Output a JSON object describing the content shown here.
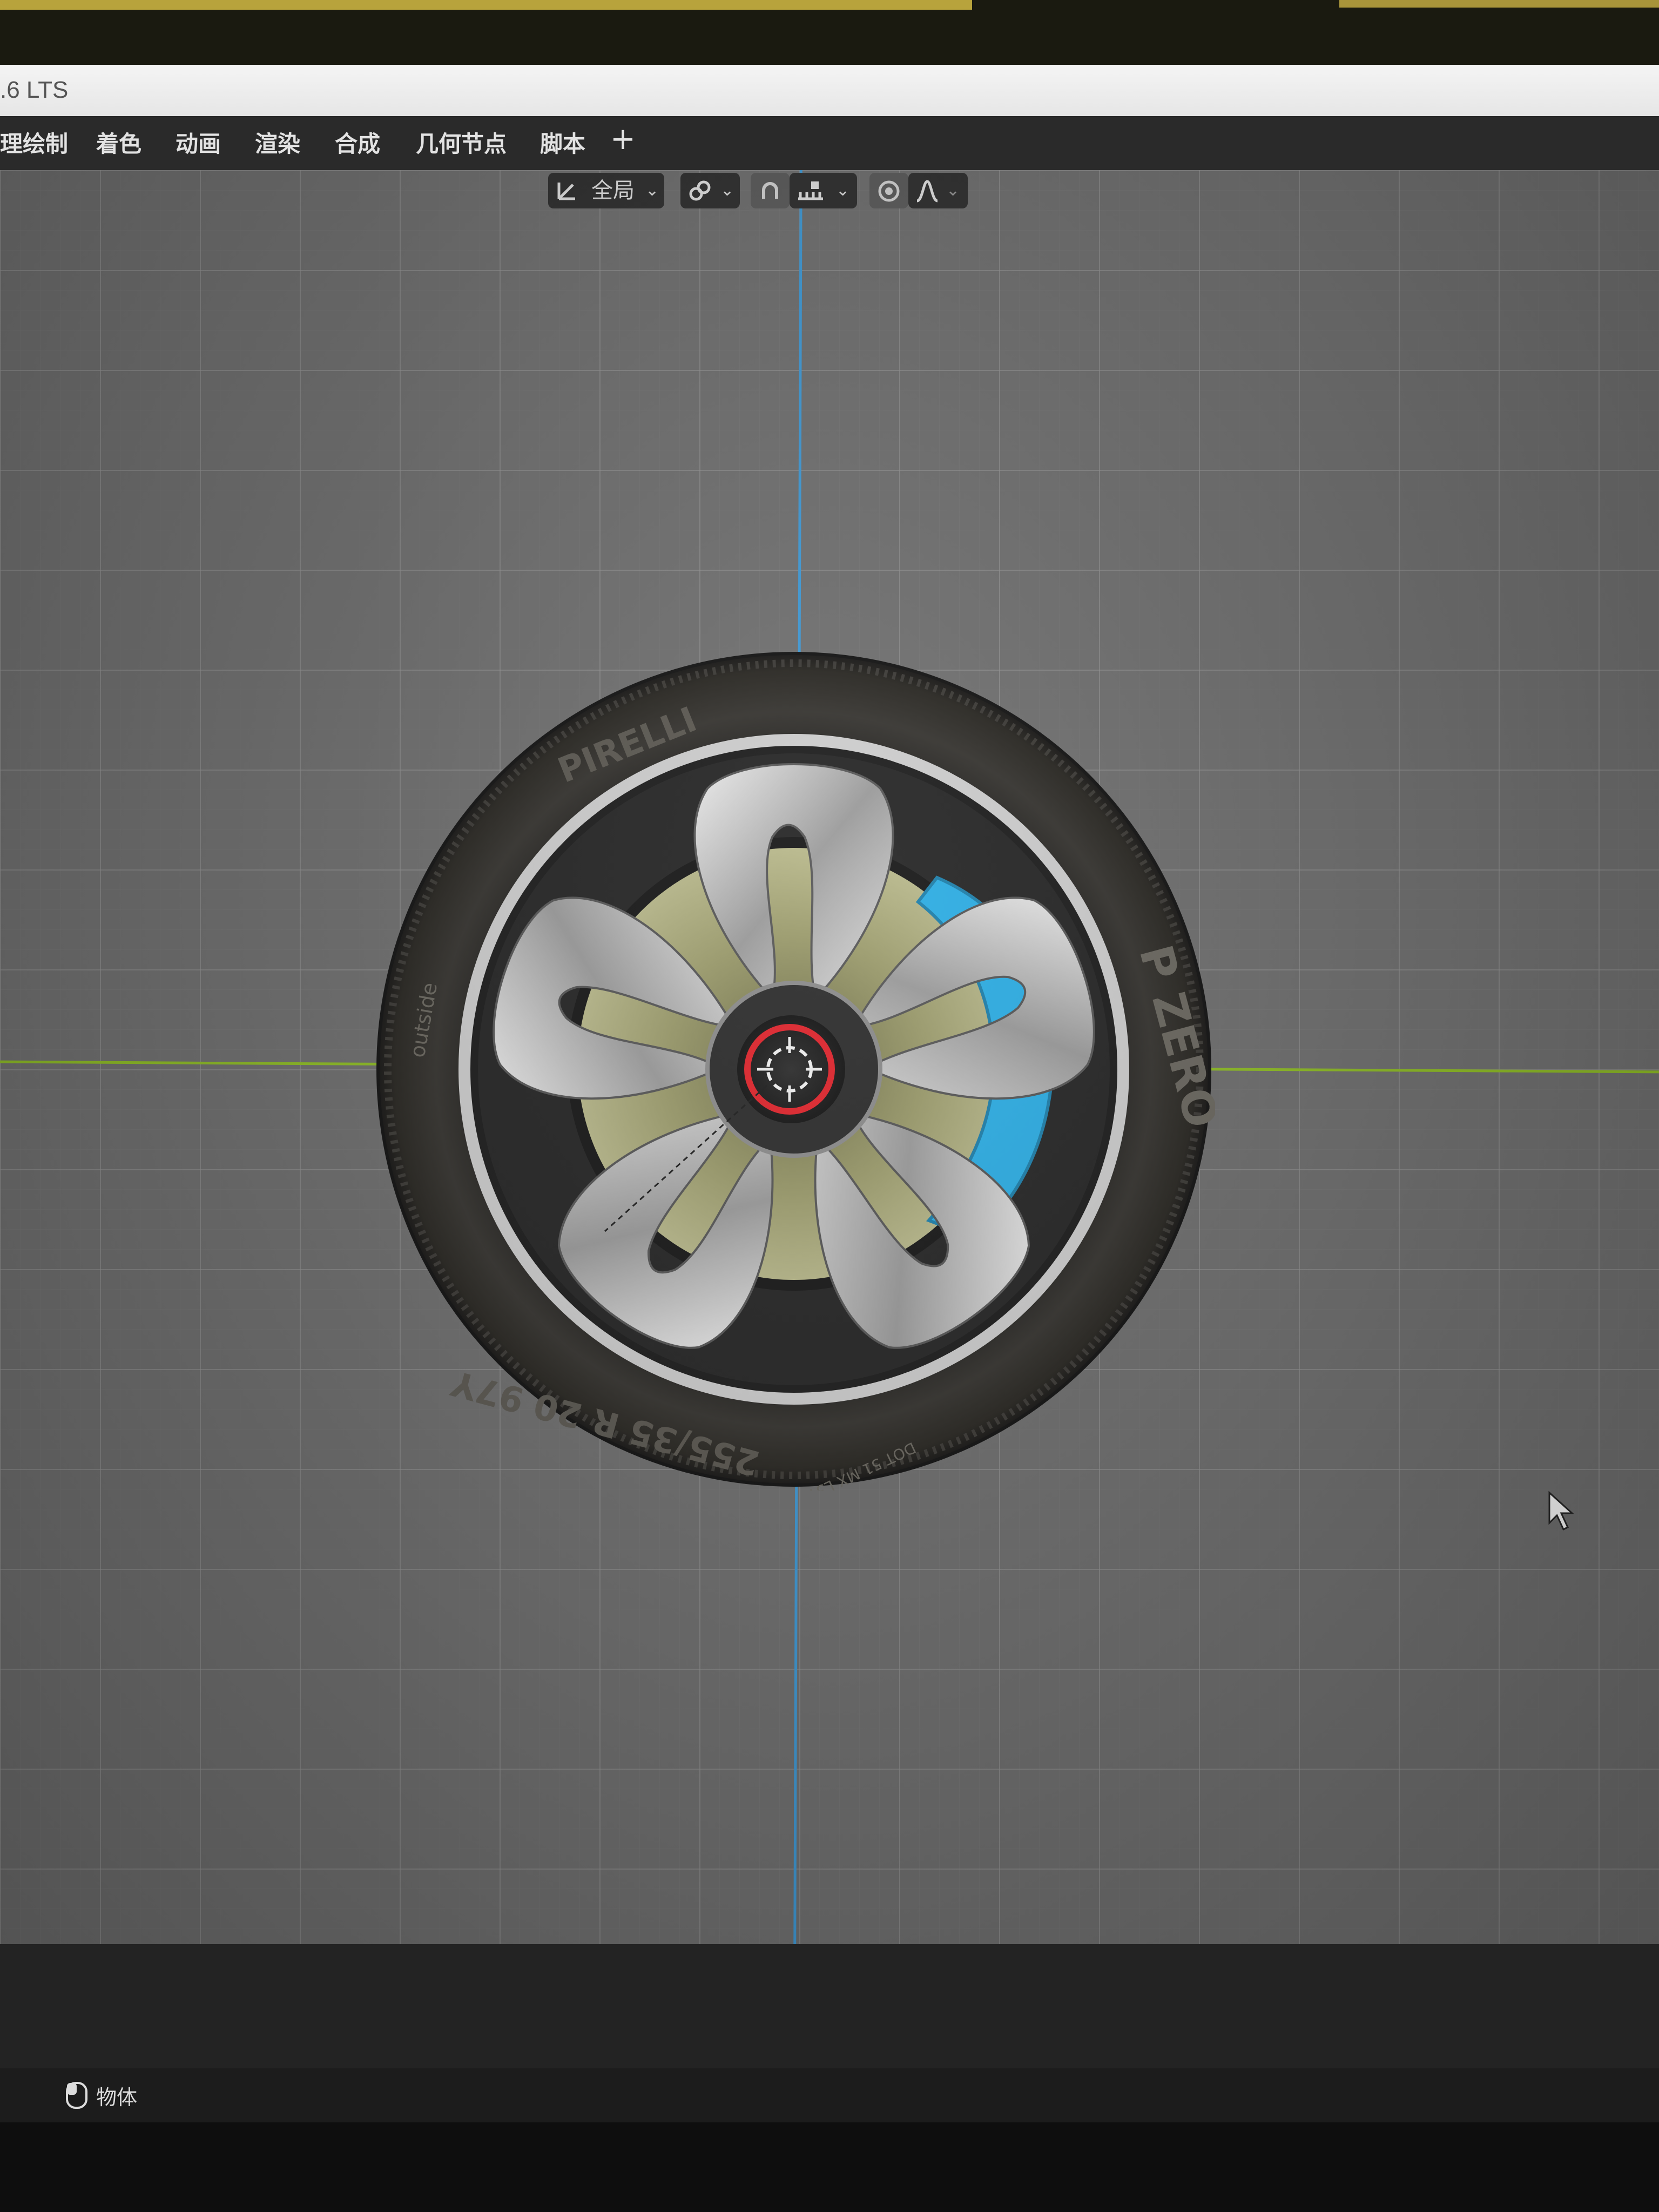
{
  "window": {
    "title": ".6 LTS"
  },
  "workspace_tabs": [
    {
      "label": "理绘制"
    },
    {
      "label": "着色"
    },
    {
      "label": "动画"
    },
    {
      "label": "渲染"
    },
    {
      "label": "合成"
    },
    {
      "label": "几何节点"
    },
    {
      "label": "脚本"
    }
  ],
  "add_tab_label": "+",
  "header_toolbar": {
    "transform_orientation": "全局",
    "icons": [
      "transform-orientation-icon",
      "pivot-link-icon",
      "snap-magnet-icon",
      "snap-increment-icon",
      "proportional-edit-icon",
      "falloff-curve-icon"
    ]
  },
  "tire": {
    "brand": "PIRELLI",
    "model": "P ZERO",
    "size": "255/35 R 20 97Y",
    "side_label": "outside",
    "dot_code": "DOT 51 MX L3Y1",
    "caliper_color": "#2aaee6"
  },
  "axis_colors": {
    "x": "#8fbf22",
    "y": "#3d9ad8"
  },
  "status_bar": {
    "mode_label": "物体"
  }
}
